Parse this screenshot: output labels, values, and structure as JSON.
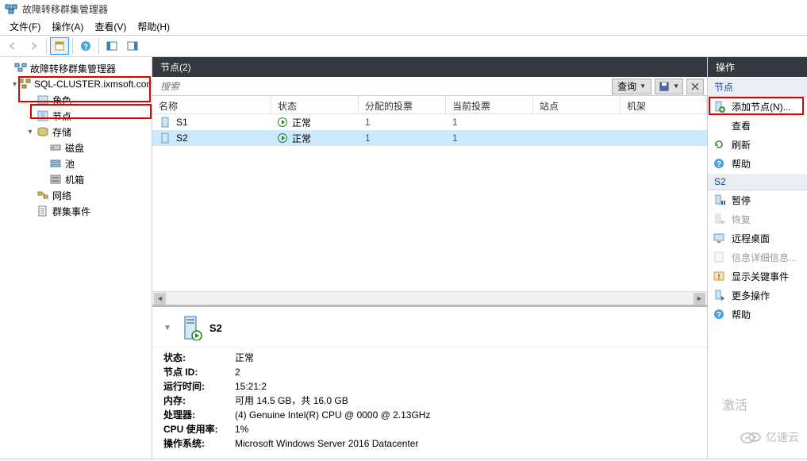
{
  "window": {
    "title": "故障转移群集管理器"
  },
  "menubar": [
    "文件(F)",
    "操作(A)",
    "查看(V)",
    "帮助(H)"
  ],
  "tree": {
    "root": "故障转移群集管理器",
    "cluster": "SQL-CLUSTER.ixmsoft.com",
    "roles": "角色",
    "nodes": "节点",
    "storage": "存储",
    "disks": "磁盘",
    "pools": "池",
    "enclosures": "机箱",
    "networks": "网络",
    "events": "群集事件"
  },
  "center": {
    "title": "节点(2)",
    "search_placeholder": "搜索",
    "query_btn": "查询",
    "columns": [
      "名称",
      "状态",
      "分配的投票",
      "当前投票",
      "站点",
      "机架"
    ],
    "rows": [
      {
        "name": "S1",
        "status": "正常",
        "assigned": "1",
        "current": "1",
        "site": "",
        "rack": ""
      },
      {
        "name": "S2",
        "status": "正常",
        "assigned": "1",
        "current": "1",
        "site": "",
        "rack": ""
      }
    ]
  },
  "detail": {
    "name": "S2",
    "rows": [
      {
        "k": "状态:",
        "v": "正常"
      },
      {
        "k": "节点 ID:",
        "v": "2"
      },
      {
        "k": "运行时间:",
        "v": "15:21:2"
      },
      {
        "k": "内存:",
        "v": "可用 14.5 GB，共 16.0 GB"
      },
      {
        "k": "处理器:",
        "v": "(4) Genuine Intel(R) CPU        @ 0000 @ 2.13GHz"
      },
      {
        "k": "CPU 使用率:",
        "v": "1%"
      },
      {
        "k": "操作系统:",
        "v": "Microsoft Windows Server 2016 Datacenter"
      }
    ]
  },
  "actions": {
    "header": "操作",
    "section1": "节点",
    "items1": [
      "添加节点(N)...",
      "查看",
      "刷新",
      "帮助"
    ],
    "section2": "S2",
    "items2": [
      "暂停",
      "恢复",
      "远程桌面",
      "信息详细信息...",
      "显示关键事件",
      "更多操作",
      "帮助"
    ]
  },
  "watermark": "亿速云",
  "activate_text": "激活"
}
